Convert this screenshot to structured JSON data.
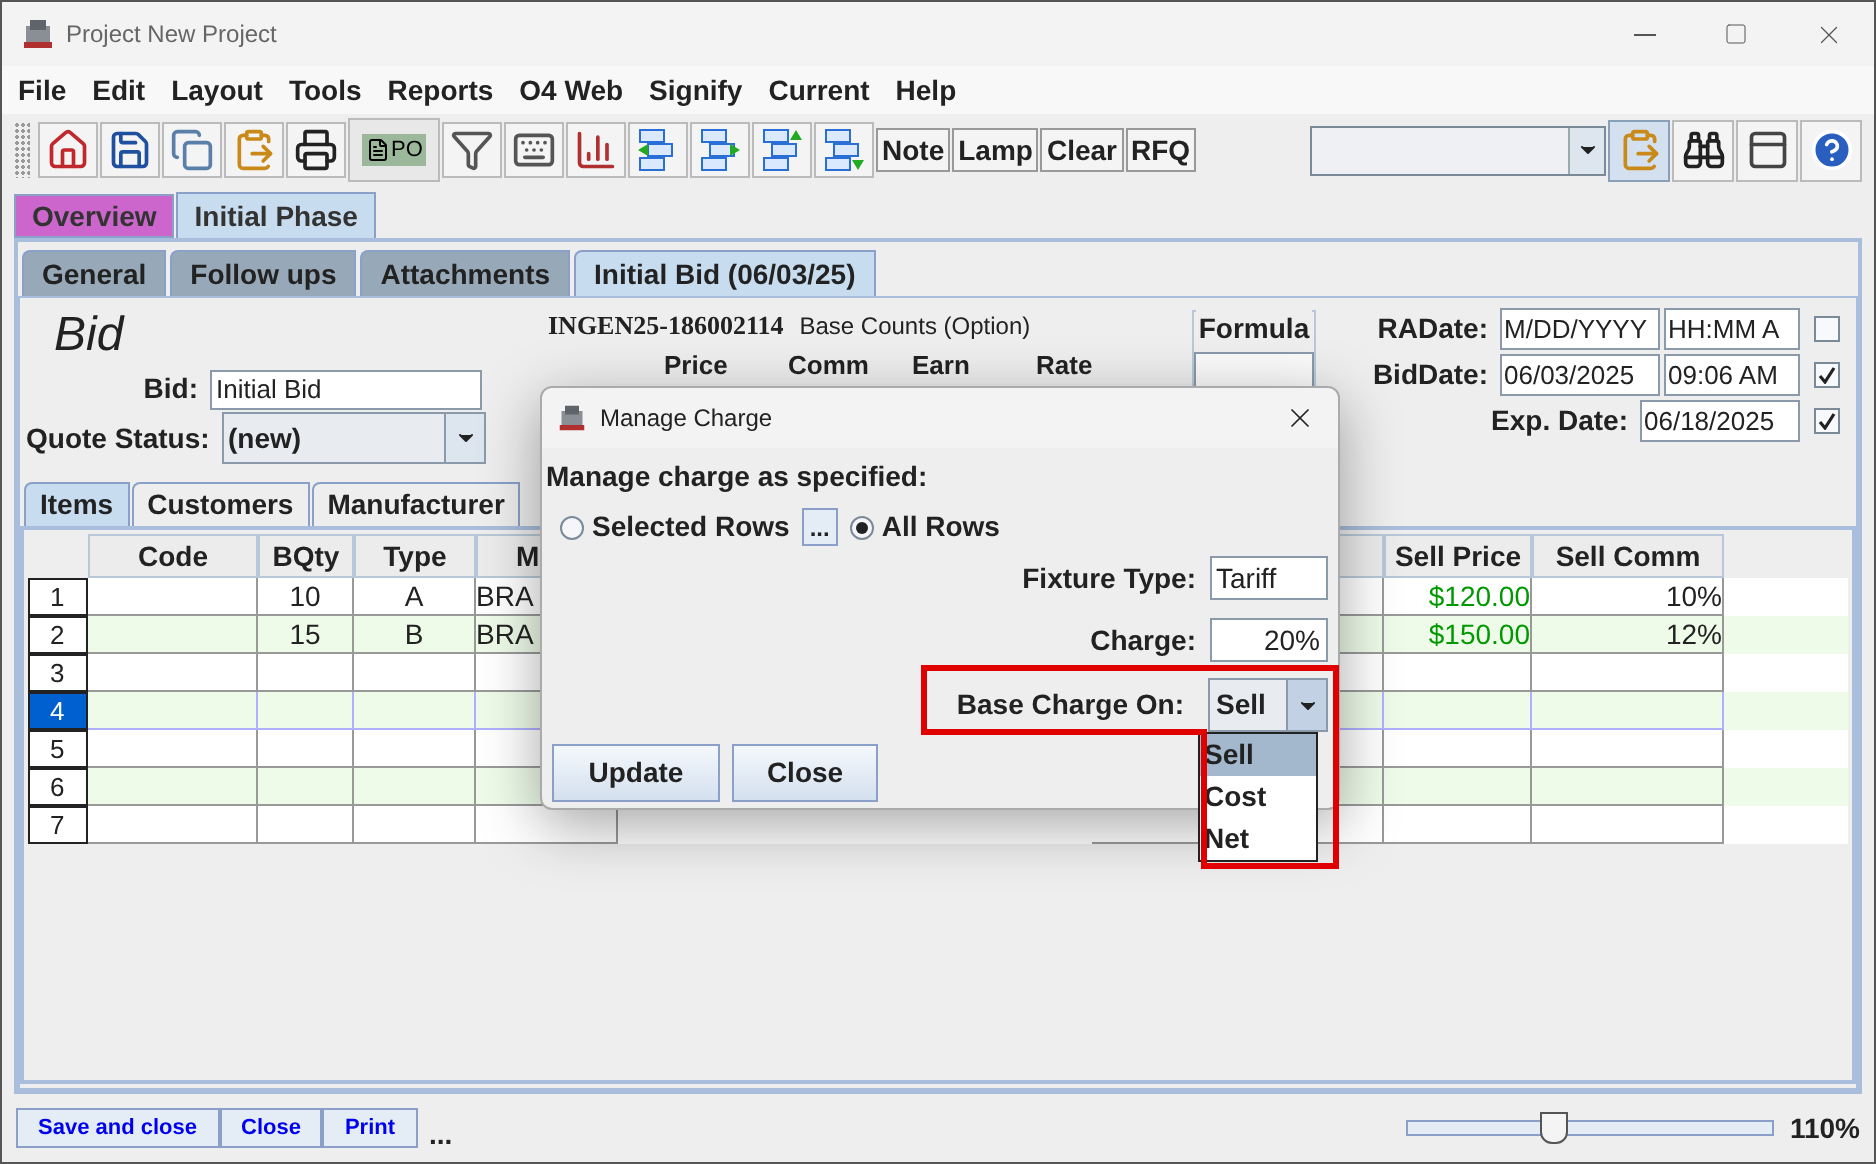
{
  "window": {
    "title": "Project New Project"
  },
  "menu": [
    "File",
    "Edit",
    "Layout",
    "Tools",
    "Reports",
    "O4 Web",
    "Signify",
    "Current",
    "Help"
  ],
  "toolbar": [
    {
      "kind": "home"
    },
    {
      "kind": "save"
    },
    {
      "kind": "copy"
    },
    {
      "kind": "paste"
    },
    {
      "kind": "print"
    },
    {
      "kind": "po",
      "label": "PO"
    },
    {
      "kind": "filter"
    },
    {
      "kind": "keyboard"
    },
    {
      "kind": "chart"
    },
    {
      "kind": "move-left"
    },
    {
      "kind": "move-right"
    },
    {
      "kind": "move-up"
    },
    {
      "kind": "move-down"
    },
    {
      "kind": "text",
      "label": "Note"
    },
    {
      "kind": "text",
      "label": "Lamp"
    },
    {
      "kind": "text",
      "label": "Clear"
    },
    {
      "kind": "text",
      "label": "RFQ"
    }
  ],
  "toolbar_right": [
    {
      "kind": "paste",
      "selected": true
    },
    {
      "kind": "binoculars",
      "selected": false
    },
    {
      "kind": "panel",
      "selected": false
    },
    {
      "kind": "help",
      "selected": false
    }
  ],
  "tabs": [
    {
      "label": "Overview",
      "selected": false,
      "color": "#cc66cc"
    },
    {
      "label": "Initial Phase",
      "selected": true,
      "color": "#c8dcf0"
    }
  ],
  "subtabs": [
    {
      "label": "General",
      "selected": false
    },
    {
      "label": "Follow ups",
      "selected": false
    },
    {
      "label": "Attachments",
      "selected": false
    },
    {
      "label": "Initial Bid (06/03/25)",
      "selected": true
    }
  ],
  "bid": {
    "title": "Bid",
    "bid_label": "Bid:",
    "bid_value": "Initial Bid",
    "status_label": "Quote Status:",
    "status_value": "(new)"
  },
  "base_counts": {
    "number": "INGEN25-186002114",
    "caption": "Base Counts (Option)",
    "columns": [
      "Price",
      "Comm",
      "Earn",
      "Rate"
    ]
  },
  "formula": {
    "label": "Formula"
  },
  "dates": [
    {
      "label": "RADate:",
      "date": "M/DD/YYYY",
      "time": "HH:MM A",
      "checked": false
    },
    {
      "label": "BidDate:",
      "date": "06/03/2025",
      "time": "09:06 AM",
      "checked": true
    },
    {
      "label": "Exp. Date:",
      "date": "06/18/2025",
      "checked": true
    }
  ],
  "item_tabs": [
    {
      "label": "Items",
      "selected": true
    },
    {
      "label": "Customers",
      "selected": false
    },
    {
      "label": "Manufacturer",
      "selected": false
    }
  ],
  "table": {
    "columns": [
      {
        "label": "Code"
      },
      {
        "label": "BQty"
      },
      {
        "label": "Type"
      },
      {
        "label": "M"
      },
      {},
      {
        "label": "Sell Price"
      },
      {
        "label": "Sell Comm"
      }
    ],
    "rows": [
      {
        "number": "1",
        "selected": false,
        "bqty": "10",
        "type": "A",
        "column_4": "BRA",
        "sell_price": "$120.00",
        "sell_comm": "10%"
      },
      {
        "number": "2",
        "selected": false,
        "bqty": "15",
        "type": "B",
        "column_4": "BRA",
        "sell_price": "$150.00",
        "sell_comm": "12%"
      },
      {
        "number": "3",
        "selected": false
      },
      {
        "number": "4",
        "selected": true
      },
      {
        "number": "5",
        "selected": false
      },
      {
        "number": "6",
        "selected": false
      },
      {
        "number": "7",
        "selected": false
      }
    ]
  },
  "bottom": {
    "buttons": [
      "Save and close",
      "Close",
      "Print"
    ],
    "more": "...",
    "zoom": {
      "level": 0.4,
      "reading": "110%"
    }
  },
  "dialog": {
    "title": "Manage Charge",
    "heading": "Manage charge as specified:",
    "scope": [
      {
        "label": "Selected Rows",
        "selected": false
      },
      {
        "label": "All Rows",
        "selected": true
      }
    ],
    "picker": "...",
    "fixture_label": "Fixture Type:",
    "fixture_value": "Tariff",
    "charge_label": "Charge:",
    "charge_value": "20%",
    "base_label": "Base Charge On:",
    "base_value": "Sell",
    "expanded": true,
    "options": [
      {
        "label": "Sell",
        "selected": true
      },
      {
        "label": "Cost",
        "selected": false
      },
      {
        "label": "Net",
        "selected": false
      }
    ],
    "buttons": [
      "Update",
      "Close"
    ]
  }
}
